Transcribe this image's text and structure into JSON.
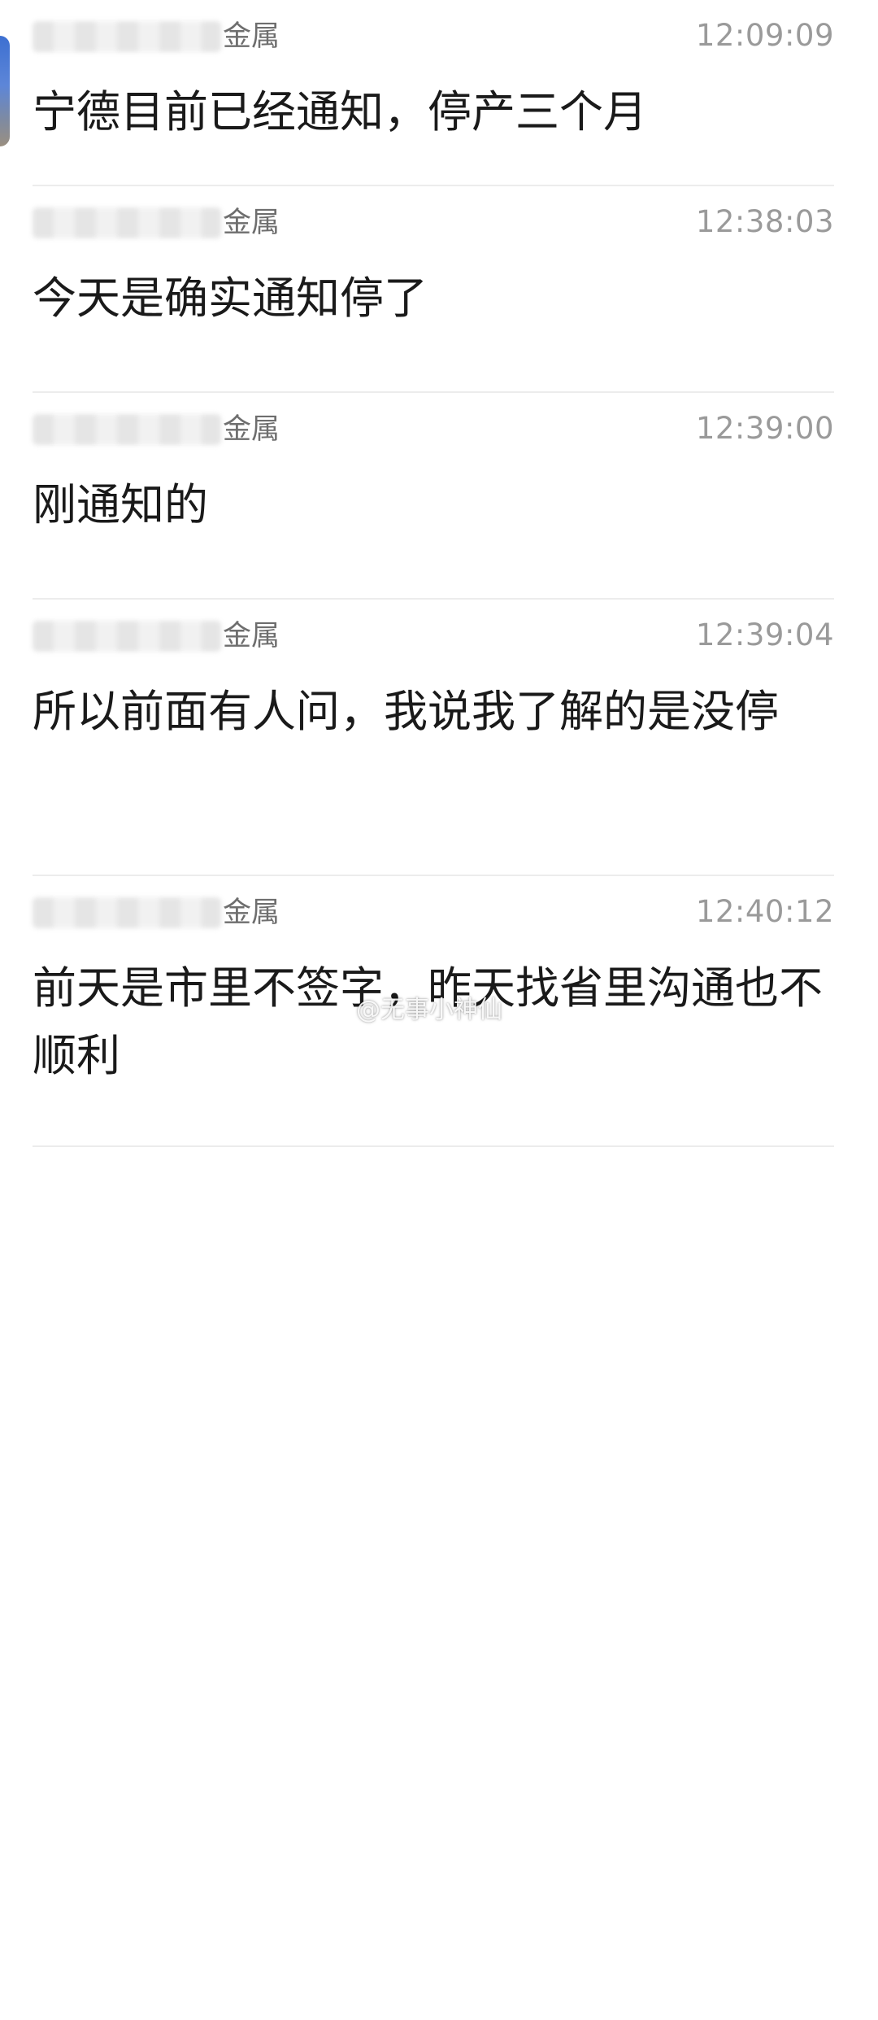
{
  "messages": [
    {
      "sender_suffix": "金属",
      "time": "12:09:09",
      "text": "宁德目前已经通知，停产三个月"
    },
    {
      "sender_suffix": "金属",
      "time": "12:38:03",
      "text": "今天是确实通知停了"
    },
    {
      "sender_suffix": "金属",
      "time": "12:39:00",
      "text": "刚通知的"
    },
    {
      "sender_suffix": "金属",
      "time": "12:39:04",
      "text": "所以前面有人问，我说我了解的是没停"
    },
    {
      "sender_suffix": "金属",
      "time": "12:40:12",
      "text": "前天是市里不签字，昨天找省里沟通也不顺利"
    }
  ],
  "watermark": "@无事小神仙"
}
